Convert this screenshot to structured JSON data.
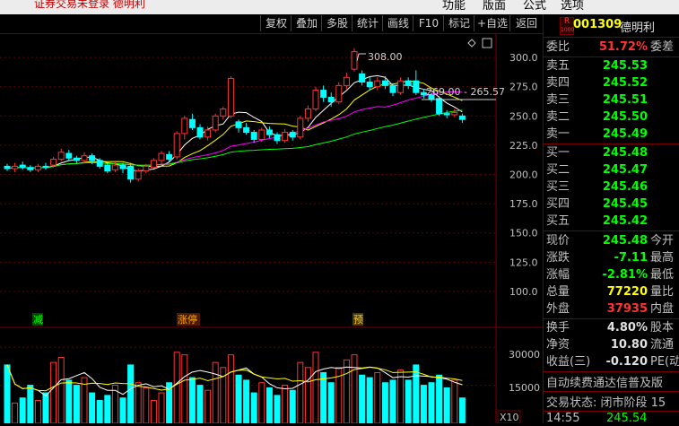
{
  "topbar": {
    "status_text": "证券交易未登录  德明利",
    "menu": [
      "功能",
      "版面",
      "公式",
      "选项"
    ]
  },
  "toolbar": {
    "buttons": [
      "复权",
      "叠加",
      "多股",
      "统计",
      "画线",
      "F10",
      "标记",
      "+自选",
      "返回"
    ]
  },
  "chart": {
    "price_ticks": [
      "300.0",
      "275.0",
      "250.0",
      "225.0",
      "200.0",
      "175.0",
      "150.0",
      "125.0",
      "100.0"
    ],
    "vol_ticks": [
      "30000",
      "15000"
    ],
    "vol_unit": "X10",
    "high_label": "308.00",
    "range_label": "269.00 - 265.57",
    "markers": [
      "减",
      "涨停",
      "预"
    ]
  },
  "chart_data": {
    "type": "candlestick",
    "ylim": [
      90,
      320
    ],
    "candles": [
      {
        "o": 207,
        "c": 205,
        "h": 209,
        "l": 203
      },
      {
        "o": 205,
        "c": 207,
        "h": 210,
        "l": 202
      },
      {
        "o": 208,
        "c": 206,
        "h": 211,
        "l": 204
      },
      {
        "o": 206,
        "c": 204,
        "h": 208,
        "l": 202
      },
      {
        "o": 204,
        "c": 207,
        "h": 209,
        "l": 202
      },
      {
        "o": 207,
        "c": 206,
        "h": 210,
        "l": 204
      },
      {
        "o": 208,
        "c": 213,
        "h": 215,
        "l": 206
      },
      {
        "o": 213,
        "c": 219,
        "h": 222,
        "l": 211
      },
      {
        "o": 218,
        "c": 214,
        "h": 221,
        "l": 212
      },
      {
        "o": 214,
        "c": 212,
        "h": 216,
        "l": 209
      },
      {
        "o": 212,
        "c": 216,
        "h": 219,
        "l": 210
      },
      {
        "o": 216,
        "c": 212,
        "h": 218,
        "l": 209
      },
      {
        "o": 212,
        "c": 207,
        "h": 214,
        "l": 205
      },
      {
        "o": 208,
        "c": 203,
        "h": 210,
        "l": 201
      },
      {
        "o": 204,
        "c": 208,
        "h": 211,
        "l": 202
      },
      {
        "o": 208,
        "c": 205,
        "h": 210,
        "l": 201
      },
      {
        "o": 207,
        "c": 196,
        "h": 210,
        "l": 193
      },
      {
        "o": 196,
        "c": 203,
        "h": 205,
        "l": 194
      },
      {
        "o": 203,
        "c": 207,
        "h": 209,
        "l": 201
      },
      {
        "o": 206,
        "c": 212,
        "h": 214,
        "l": 205
      },
      {
        "o": 212,
        "c": 218,
        "h": 220,
        "l": 209
      },
      {
        "o": 217,
        "c": 213,
        "h": 220,
        "l": 211
      },
      {
        "o": 215,
        "c": 235,
        "h": 237,
        "l": 213
      },
      {
        "o": 235,
        "c": 248,
        "h": 250,
        "l": 230
      },
      {
        "o": 247,
        "c": 240,
        "h": 252,
        "l": 238
      },
      {
        "o": 240,
        "c": 232,
        "h": 243,
        "l": 230
      },
      {
        "o": 232,
        "c": 238,
        "h": 241,
        "l": 229
      },
      {
        "o": 238,
        "c": 250,
        "h": 252,
        "l": 236
      },
      {
        "o": 250,
        "c": 256,
        "h": 258,
        "l": 247
      },
      {
        "o": 250,
        "c": 282,
        "h": 284,
        "l": 248
      },
      {
        "o": 245,
        "c": 240,
        "h": 247,
        "l": 236
      },
      {
        "o": 240,
        "c": 236,
        "h": 244,
        "l": 234
      },
      {
        "o": 236,
        "c": 230,
        "h": 238,
        "l": 227
      },
      {
        "o": 230,
        "c": 238,
        "h": 240,
        "l": 228
      },
      {
        "o": 238,
        "c": 234,
        "h": 241,
        "l": 231
      },
      {
        "o": 234,
        "c": 229,
        "h": 236,
        "l": 226
      },
      {
        "o": 229,
        "c": 236,
        "h": 239,
        "l": 227
      },
      {
        "o": 236,
        "c": 232,
        "h": 238,
        "l": 229
      },
      {
        "o": 232,
        "c": 248,
        "h": 250,
        "l": 230
      },
      {
        "o": 248,
        "c": 256,
        "h": 259,
        "l": 245
      },
      {
        "o": 256,
        "c": 272,
        "h": 275,
        "l": 254
      },
      {
        "o": 272,
        "c": 266,
        "h": 276,
        "l": 262
      },
      {
        "o": 266,
        "c": 262,
        "h": 270,
        "l": 258
      },
      {
        "o": 262,
        "c": 276,
        "h": 279,
        "l": 260
      },
      {
        "o": 276,
        "c": 283,
        "h": 287,
        "l": 273
      },
      {
        "o": 290,
        "c": 305,
        "h": 308,
        "l": 288
      },
      {
        "o": 286,
        "c": 279,
        "h": 289,
        "l": 276
      },
      {
        "o": 279,
        "c": 275,
        "h": 283,
        "l": 272
      },
      {
        "o": 275,
        "c": 280,
        "h": 283,
        "l": 272
      },
      {
        "o": 280,
        "c": 276,
        "h": 284,
        "l": 273
      },
      {
        "o": 276,
        "c": 270,
        "h": 278,
        "l": 267
      },
      {
        "o": 270,
        "c": 280,
        "h": 283,
        "l": 268
      },
      {
        "o": 280,
        "c": 276,
        "h": 283,
        "l": 273
      },
      {
        "o": 280,
        "c": 270,
        "h": 289,
        "l": 268
      },
      {
        "o": 270,
        "c": 268,
        "h": 273,
        "l": 265
      },
      {
        "o": 268,
        "c": 264,
        "h": 270,
        "l": 262
      },
      {
        "o": 265,
        "c": 252,
        "h": 267,
        "l": 250
      },
      {
        "o": 252,
        "c": 251,
        "h": 255,
        "l": 248
      },
      {
        "o": 251,
        "c": 253,
        "h": 256,
        "l": 249
      },
      {
        "o": 250,
        "c": 247,
        "h": 252,
        "l": 244
      }
    ],
    "ma_series": [
      {
        "color": "#ffffff",
        "values": []
      },
      {
        "color": "#ffff00",
        "values": []
      },
      {
        "color": "#ff00ff",
        "values": []
      },
      {
        "color": "#00ff00",
        "values": []
      }
    ],
    "volumes": [
      23000,
      8000,
      10000,
      15000,
      9000,
      12000,
      24000,
      26000,
      17000,
      15000,
      18000,
      12000,
      9000,
      11000,
      15000,
      10000,
      23000,
      16000,
      14000,
      9000,
      12000,
      16000,
      28000,
      27000,
      18000,
      15000,
      13000,
      24000,
      22000,
      27000,
      19000,
      17000,
      12000,
      16000,
      14000,
      11000,
      15000,
      13000,
      24000,
      22000,
      28000,
      20000,
      16000,
      22000,
      25000,
      27000,
      19000,
      18000,
      20000,
      16000,
      17000,
      21000,
      17000,
      23000,
      15000,
      16000,
      19000,
      14000,
      17000,
      10000
    ],
    "vol_ylim": [
      0,
      35000
    ]
  },
  "panel": {
    "badge_top": "R",
    "badge_bottom": "1000",
    "code": "001309",
    "name": "德明利",
    "webi": {
      "label": "委比",
      "value": "51.72%",
      "label2": "委差"
    },
    "asks": [
      {
        "label": "卖五",
        "price": "245.53"
      },
      {
        "label": "卖四",
        "price": "245.52"
      },
      {
        "label": "卖三",
        "price": "245.51"
      },
      {
        "label": "卖二",
        "price": "245.50"
      },
      {
        "label": "卖一",
        "price": "245.49"
      }
    ],
    "bids": [
      {
        "label": "买一",
        "price": "245.48"
      },
      {
        "label": "买二",
        "price": "245.47"
      },
      {
        "label": "买三",
        "price": "245.46"
      },
      {
        "label": "买四",
        "price": "245.45"
      },
      {
        "label": "买五",
        "price": "245.42"
      }
    ],
    "quote": [
      {
        "label": "现价",
        "value": "245.48",
        "label2": "今开"
      },
      {
        "label": "涨跌",
        "value": "-7.11",
        "label2": "最高"
      },
      {
        "label": "涨幅",
        "value": "-2.81%",
        "label2": "最低"
      },
      {
        "label": "总量",
        "value": "77220",
        "label2": "量比"
      },
      {
        "label": "外盘",
        "value": "37935",
        "label2": "内盘"
      }
    ],
    "fin": [
      {
        "label": "换手",
        "value": "4.80%",
        "label2": "股本"
      },
      {
        "label": "净资",
        "value": "10.80",
        "label2": "流通"
      },
      {
        "label": "收益(三)",
        "value": "-0.120",
        "label2": "PE(动"
      }
    ],
    "notice": "自动续费通达信普及版",
    "trade_status": "交易状态: 闭市阶段 15",
    "tick_time": "14:55",
    "tick_price": "245.54"
  },
  "colors": {
    "up": "#ff3333",
    "down": "#00ffff",
    "border": "#7a0000"
  }
}
